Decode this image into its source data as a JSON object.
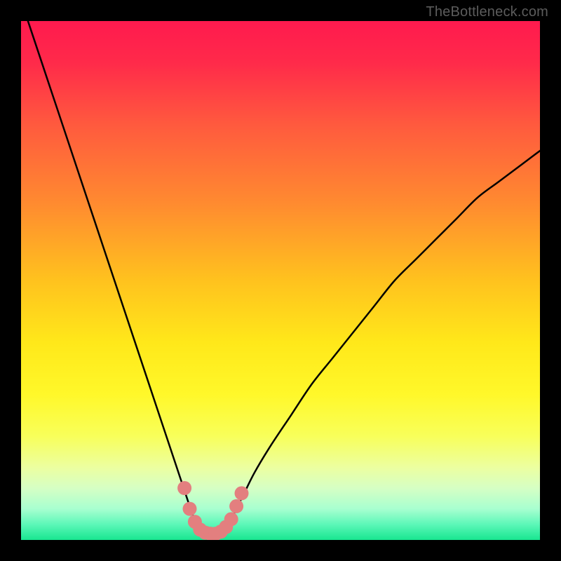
{
  "watermark": "TheBottleneck.com",
  "chart_data": {
    "type": "line",
    "title": "",
    "xlabel": "",
    "ylabel": "",
    "xlim": [
      0,
      100
    ],
    "ylim": [
      0,
      100
    ],
    "grid": false,
    "legend": false,
    "series": [
      {
        "name": "bottleneck-curve",
        "x": [
          0,
          2,
          4,
          6,
          8,
          10,
          12,
          14,
          16,
          18,
          20,
          22,
          24,
          26,
          28,
          30,
          32,
          33,
          34,
          35,
          36,
          37,
          38,
          39,
          40,
          41,
          43,
          45,
          48,
          52,
          56,
          60,
          64,
          68,
          72,
          76,
          80,
          84,
          88,
          92,
          96,
          100
        ],
        "y": [
          104,
          98,
          92,
          86,
          80,
          74,
          68,
          62,
          56,
          50,
          44,
          38,
          32,
          26,
          20,
          14,
          8,
          5,
          3,
          2,
          1,
          1,
          1,
          2,
          3,
          5,
          9,
          13,
          18,
          24,
          30,
          35,
          40,
          45,
          50,
          54,
          58,
          62,
          66,
          69,
          72,
          75
        ]
      },
      {
        "name": "valley-highlight",
        "x": [
          31.5,
          32.5,
          33.5,
          34.5,
          35.5,
          36.5,
          37.5,
          38.5,
          39.5,
          40.5,
          41.5,
          42.5
        ],
        "y": [
          10,
          6,
          3.5,
          2,
          1.4,
          1.2,
          1.2,
          1.6,
          2.5,
          4,
          6.5,
          9
        ]
      }
    ],
    "gradient_stops": [
      {
        "offset": 0.0,
        "color": "#ff1a4e"
      },
      {
        "offset": 0.08,
        "color": "#ff2a4a"
      },
      {
        "offset": 0.2,
        "color": "#ff5a3e"
      },
      {
        "offset": 0.35,
        "color": "#ff8a30"
      },
      {
        "offset": 0.5,
        "color": "#ffc21e"
      },
      {
        "offset": 0.62,
        "color": "#ffe81a"
      },
      {
        "offset": 0.72,
        "color": "#fff82a"
      },
      {
        "offset": 0.8,
        "color": "#f8ff5a"
      },
      {
        "offset": 0.86,
        "color": "#ecffa0"
      },
      {
        "offset": 0.9,
        "color": "#d6ffc4"
      },
      {
        "offset": 0.94,
        "color": "#a8ffd0"
      },
      {
        "offset": 0.97,
        "color": "#5cf7b8"
      },
      {
        "offset": 1.0,
        "color": "#18e690"
      }
    ]
  }
}
